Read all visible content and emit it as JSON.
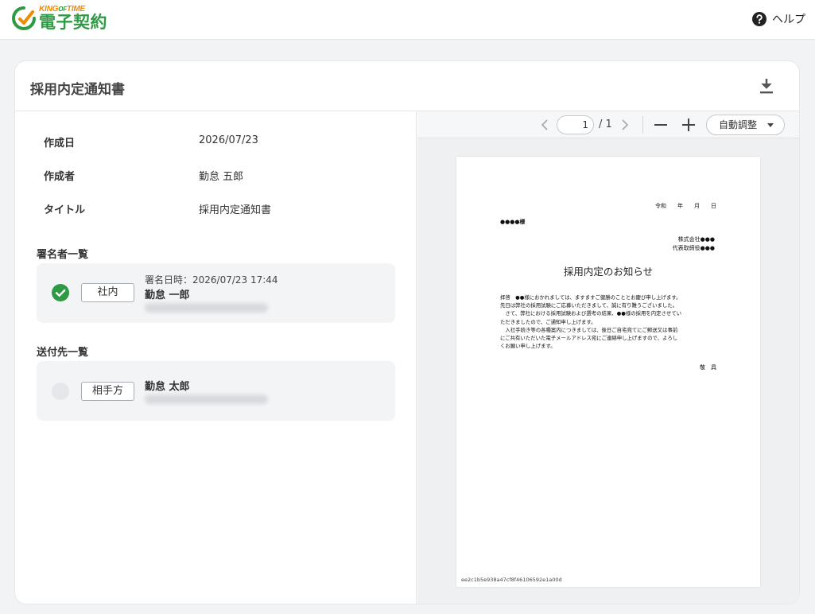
{
  "header": {
    "brand": "KING",
    "brand_of": "OF",
    "brand_time": "TIME",
    "product": "電子契約",
    "help_label": "ヘルプ"
  },
  "document": {
    "title": "採用内定通知書",
    "info": [
      {
        "label": "作成日",
        "value": "2026/07/23"
      },
      {
        "label": "作成者",
        "value": "勤怠 五郎"
      },
      {
        "label": "タイトル",
        "value": "採用内定通知書"
      }
    ]
  },
  "signers": {
    "section_title": "署名者一覧",
    "items": [
      {
        "status": "signed",
        "role": "社内",
        "signed_at": "署名日時：2026/07/23 17:44",
        "name": "勤怠 一郎"
      }
    ]
  },
  "recipients": {
    "section_title": "送付先一覧",
    "items": [
      {
        "status": "pending",
        "role": "相手方",
        "name": "勤怠 太郎"
      }
    ]
  },
  "viewer": {
    "page_current": "1",
    "page_total": "/ 1",
    "zoom_label": "自動調整"
  },
  "pdf": {
    "date_line": "令和　　年　　月　　日",
    "recipient": "●●●●様",
    "company": "株式会社●●●",
    "representative": "代表取締役●●●",
    "heading": "採用内定のお知らせ",
    "body": [
      "拝啓　●●様におかれましては、ますますご健勝のこととお慶び申し上げます。",
      "先日は弊社の採用試験にご応募いただきまして、誠に有り難うございました。",
      "　さて、弊社における採用試験および選考の結果、●●様の採用を内定させてい",
      "ただきましたので、ご通知申し上げます。",
      "　入社手続き等の各種案内につきましては、後日ご自宅宛てにご郵送又は事前",
      "にご共有いただいた電子メールアドレス宛にご連絡申し上げますので、よろし",
      "くお願い申し上げます。"
    ],
    "closing": "敬　具",
    "hash": "ee2c1b5e938a47cf8f46106592e1a00d"
  },
  "colors": {
    "brand_green": "#2e9a44",
    "brand_orange": "#f08a00",
    "signed_green": "#2e9a44"
  }
}
